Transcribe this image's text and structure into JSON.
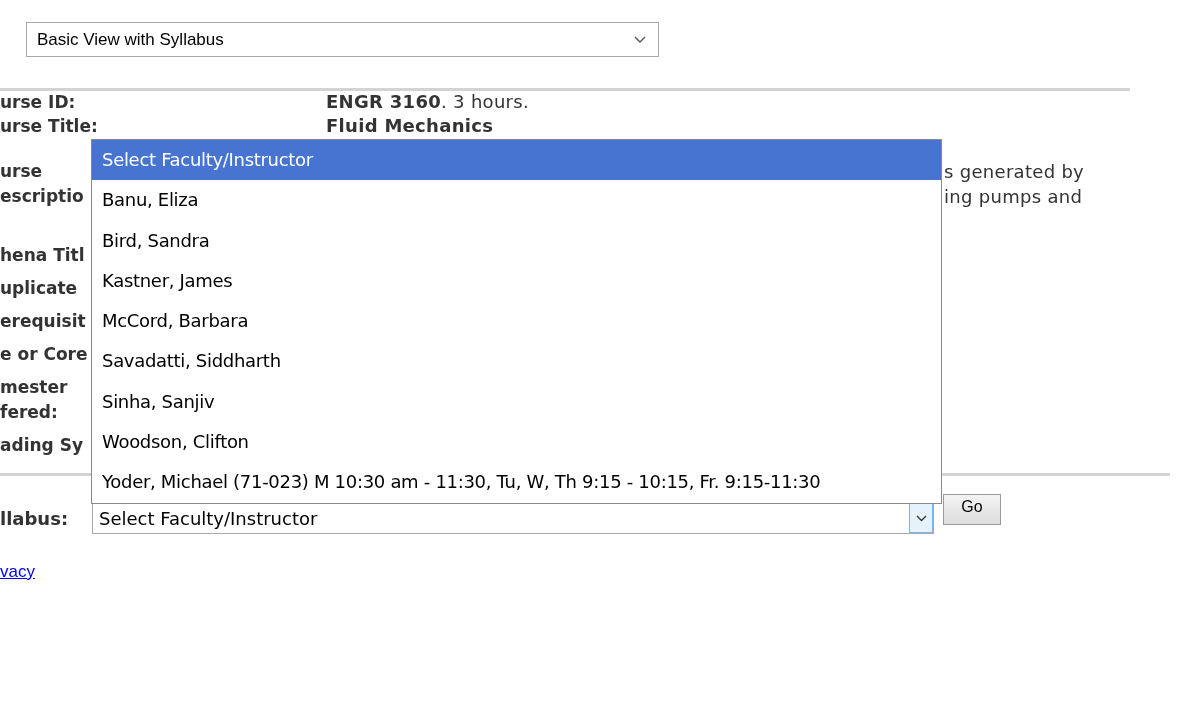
{
  "view_select": {
    "value": "Basic View with Syllabus"
  },
  "course_rows": [
    {
      "label": [
        "urse ID:"
      ],
      "value": [
        "**ENGR 3160**. 3 hours."
      ]
    },
    {
      "label": [
        "urse Title:"
      ],
      "value": [
        "Fluid Mechanics"
      ]
    },
    {
      "label": [
        "urse",
        "escriptio"
      ],
      "value": [
        "s generated by",
        "ing pumps and"
      ]
    },
    {
      "label": [
        "hena Titl"
      ]
    },
    {
      "label": [
        "uplicate"
      ]
    },
    {
      "label": [
        "erequisit"
      ]
    },
    {
      "label": [
        "e or Core"
      ]
    },
    {
      "label": [
        "mester",
        "fered:"
      ]
    },
    {
      "label": [
        "ading Sy"
      ]
    }
  ],
  "syllabus": {
    "label": "llabus:",
    "value": "Select Faculty/Instructor",
    "focused": true,
    "expanded": true,
    "options": [
      {
        "label": "Select Faculty/Instructor",
        "selected": true
      },
      {
        "label": "Banu, Eliza",
        "selected": false
      },
      {
        "label": "Bird, Sandra",
        "selected": false
      },
      {
        "label": "Kastner, James",
        "selected": false
      },
      {
        "label": "McCord, Barbara",
        "selected": false
      },
      {
        "label": "Savadatti, Siddharth",
        "selected": false
      },
      {
        "label": "Sinha, Sanjiv",
        "selected": false
      },
      {
        "label": "Woodson, Clifton",
        "selected": false
      },
      {
        "label": "Yoder, Michael (71-023) M 10:30 am - 11:30, Tu, W, Th 9:15 - 10:15, Fr. 9:15-11:30",
        "selected": false
      }
    ]
  },
  "go_button": "Go",
  "footer_link": "vacy"
}
